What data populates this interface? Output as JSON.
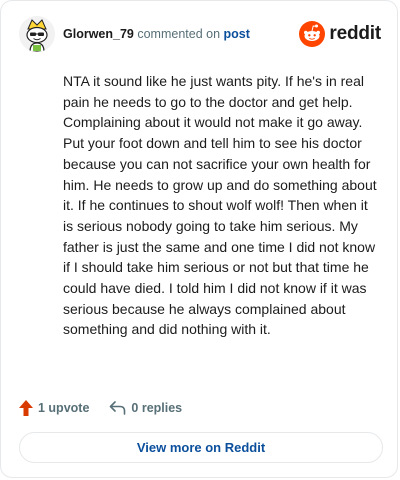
{
  "header": {
    "username": "Glorwen_79",
    "commented_on": "commented on",
    "post_link": "post",
    "brand": "reddit"
  },
  "comment": {
    "text": "NTA it sound like he just wants pity. If he's in real pain he needs to go to the doctor and get help. Complaining about it would not make it go away. Put your foot down and tell him to see his doctor because you can not sacrifice your own health for him. He needs to grow up and do something about it. If he continues to shout wolf wolf! Then when it is serious nobody going to take him serious. My father is just the same and one time I did not know if I should take him serious or not but that time he could have died. I told him I did not know if it was serious because he always complained about something and did nothing with it."
  },
  "actions": {
    "upvotes": "1 upvote",
    "replies": "0 replies"
  },
  "footer": {
    "view_more": "View more on Reddit"
  },
  "colors": {
    "reddit_orange": "#FF4500",
    "upvote_orange": "#D93A00",
    "link_blue": "#0B4F9C",
    "muted": "#576F76"
  },
  "icons": {
    "avatar": "snoo-avatar",
    "logo": "reddit-logo-icon",
    "upvote": "upvote-arrow-icon",
    "reply": "reply-arrow-icon"
  }
}
